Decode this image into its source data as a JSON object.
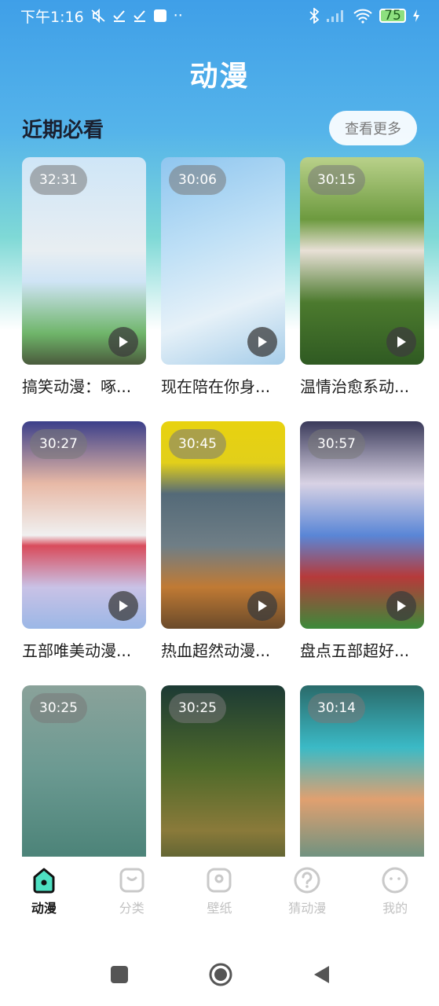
{
  "status_bar": {
    "time": "下午1:16",
    "battery": "75",
    "left_icons": [
      "mute-icon",
      "check-icon",
      "check-icon",
      "square-icon",
      "more-dots-icon"
    ],
    "right_icons": [
      "bluetooth-icon",
      "signal-icon",
      "wifi-icon",
      "battery-icon",
      "charging-icon"
    ]
  },
  "header": {
    "title": "动漫"
  },
  "section": {
    "title": "近期必看",
    "more_label": "查看更多"
  },
  "videos": [
    {
      "duration": "32:31",
      "title": "搞笑动漫：啄..."
    },
    {
      "duration": "30:06",
      "title": "现在陪在你身..."
    },
    {
      "duration": "30:15",
      "title": "温情治愈系动..."
    },
    {
      "duration": "30:27",
      "title": "五部唯美动漫..."
    },
    {
      "duration": "30:45",
      "title": "热血超然动漫..."
    },
    {
      "duration": "30:57",
      "title": "盘点五部超好..."
    },
    {
      "duration": "30:25",
      "title": ""
    },
    {
      "duration": "30:25",
      "title": ""
    },
    {
      "duration": "30:14",
      "title": ""
    }
  ],
  "tabs": [
    {
      "label": "动漫",
      "icon": "home-icon",
      "active": true
    },
    {
      "label": "分类",
      "icon": "category-icon",
      "active": false
    },
    {
      "label": "壁纸",
      "icon": "wallpaper-icon",
      "active": false
    },
    {
      "label": "猜动漫",
      "icon": "question-icon",
      "active": false
    },
    {
      "label": "我的",
      "icon": "profile-icon",
      "active": false
    }
  ],
  "nav": [
    "recent-apps-icon",
    "home-nav-icon",
    "back-icon"
  ],
  "colors": {
    "accent": "#3f9fe8",
    "active_tab": "#1a1a1a",
    "inactive_tab": "#c2c2c2"
  }
}
